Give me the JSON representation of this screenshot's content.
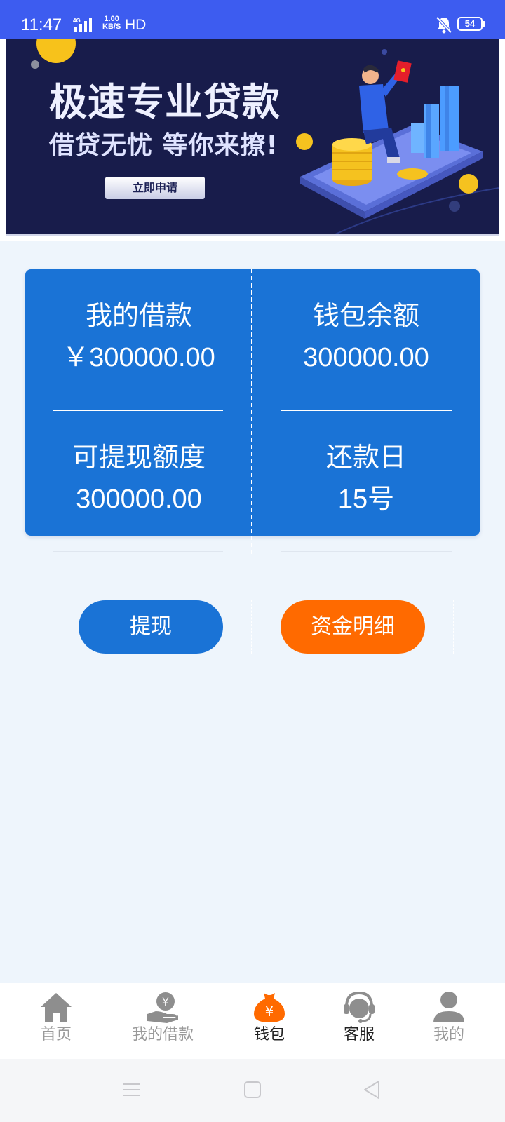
{
  "status_bar": {
    "time": "11:47",
    "network_type": "4G",
    "speed_value": "1.00",
    "speed_unit": "KB/S",
    "hd_label": "HD",
    "battery": "54",
    "icons": [
      "signal-icon",
      "mute-icon",
      "battery-icon"
    ]
  },
  "banner": {
    "headline": "极速专业贷款",
    "subline": "借贷无忧 等你来撩!",
    "button_label": "立即申请"
  },
  "summary": {
    "my_loan_label": "我的借款",
    "my_loan_value": "￥300000.00",
    "wallet_balance_label": "钱包余额",
    "wallet_balance_value": "300000.00",
    "withdrawable_label": "可提现额度",
    "withdrawable_value": "300000.00",
    "repayment_day_label": "还款日",
    "repayment_day_value": "15号"
  },
  "actions": {
    "withdraw_label": "提现",
    "fund_details_label": "资金明细"
  },
  "bottom_nav": {
    "items": [
      {
        "label": "首页",
        "icon": "home-icon"
      },
      {
        "label": "我的借款",
        "icon": "loan-hand-icon"
      },
      {
        "label": "钱包",
        "icon": "wallet-bag-icon",
        "active": true
      },
      {
        "label": "客服",
        "icon": "customer-service-icon"
      },
      {
        "label": "我的",
        "icon": "user-icon"
      }
    ]
  },
  "colors": {
    "status_bar": "#3d5cf0",
    "primary_blue": "#1a73d6",
    "accent_orange": "#ff6a00",
    "page_background": "#eef5fc",
    "nav_inactive": "#9a9a9a",
    "nav_active": "#222222"
  }
}
